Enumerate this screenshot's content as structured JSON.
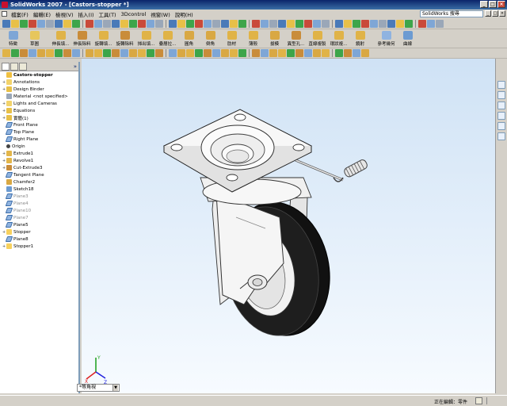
{
  "window": {
    "title": "SolidWorks 2007 - [Castors-stopper *]"
  },
  "menu": {
    "items": [
      "檔案(F)",
      "編輯(E)",
      "檢視(V)",
      "插入(I)",
      "工具(T)",
      "3Dcontrol",
      "視窗(W)",
      "說明(H)"
    ],
    "search_placeholder": "SolidWorks 搜尋"
  },
  "toolbar2": {
    "items": [
      {
        "label": "特徵",
        "icon": "feature-icon"
      },
      {
        "label": "草圖",
        "icon": "sketch-icon"
      },
      {
        "label": "伸長填...",
        "icon": "extruded-boss-icon"
      },
      {
        "label": "伸長除料",
        "icon": "extruded-cut-icon"
      },
      {
        "label": "旋轉填...",
        "icon": "revolved-boss-icon"
      },
      {
        "label": "旋轉除料",
        "icon": "revolved-cut-icon"
      },
      {
        "label": "掃出填...",
        "icon": "sweep-icon"
      },
      {
        "label": "疊層拉...",
        "icon": "loft-icon"
      },
      {
        "label": "圓角",
        "icon": "fillet-icon"
      },
      {
        "label": "倒角",
        "icon": "chamfer-icon"
      },
      {
        "label": "肋材",
        "icon": "rib-icon"
      },
      {
        "label": "薄殼",
        "icon": "shell-icon"
      },
      {
        "label": "拔模",
        "icon": "draft-icon"
      },
      {
        "label": "異型孔...",
        "icon": "hole-wizard-icon"
      },
      {
        "label": "直線複製",
        "icon": "linear-pattern-icon"
      },
      {
        "label": "環狀複...",
        "icon": "circular-pattern-icon"
      },
      {
        "label": "鏡射",
        "icon": "mirror-icon"
      },
      {
        "label": "參考幾何",
        "icon": "reference-geometry-icon"
      },
      {
        "label": "曲線",
        "icon": "curves-icon"
      }
    ]
  },
  "feature_tree": {
    "items": [
      {
        "label": "Castors-stopper",
        "icon": "part-icon",
        "expand": "",
        "dim": false,
        "root": true
      },
      {
        "label": "Annotations",
        "icon": "annotations-icon",
        "expand": "+",
        "dim": false
      },
      {
        "label": "Design Binder",
        "icon": "design-binder-icon",
        "expand": "+",
        "dim": false
      },
      {
        "label": "Material <not specified>",
        "icon": "material-icon",
        "expand": "",
        "dim": false
      },
      {
        "label": "Lights and Cameras",
        "icon": "lights-icon",
        "expand": "+",
        "dim": false
      },
      {
        "label": "Equations",
        "icon": "equations-icon",
        "expand": "+",
        "dim": false
      },
      {
        "label": "實體(1)",
        "icon": "solid-bodies-icon",
        "expand": "+",
        "dim": false
      },
      {
        "label": "Front Plane",
        "icon": "plane-icon",
        "expand": "",
        "dim": false
      },
      {
        "label": "Top Plane",
        "icon": "plane-icon",
        "expand": "",
        "dim": false
      },
      {
        "label": "Right Plane",
        "icon": "plane-icon",
        "expand": "",
        "dim": false
      },
      {
        "label": "Origin",
        "icon": "origin-icon",
        "expand": "",
        "dim": false
      },
      {
        "label": "Extrude1",
        "icon": "extrude-icon",
        "expand": "+",
        "dim": false
      },
      {
        "label": "Revolve1",
        "icon": "revolve-icon",
        "expand": "+",
        "dim": false
      },
      {
        "label": "Cut-Extrude3",
        "icon": "cut-extrude-icon",
        "expand": "+",
        "dim": false
      },
      {
        "label": "Tangent Plane",
        "icon": "plane-icon",
        "expand": "",
        "dim": false
      },
      {
        "label": "Chamfer2",
        "icon": "chamfer-icon",
        "expand": "",
        "dim": false
      },
      {
        "label": "Sketch18",
        "icon": "sketch-icon",
        "expand": "",
        "dim": false
      },
      {
        "label": "Plane3",
        "icon": "plane-icon",
        "expand": "",
        "dim": true
      },
      {
        "label": "Plane4",
        "icon": "plane-icon",
        "expand": "",
        "dim": true
      },
      {
        "label": "Plane10",
        "icon": "plane-icon",
        "expand": "",
        "dim": true
      },
      {
        "label": "Plane7",
        "icon": "plane-icon",
        "expand": "",
        "dim": true
      },
      {
        "label": "Plane5",
        "icon": "plane-icon",
        "expand": "",
        "dim": false
      },
      {
        "label": "Stopper",
        "icon": "folder-icon",
        "expand": "+",
        "dim": false
      },
      {
        "label": "Plane8",
        "icon": "plane-icon",
        "expand": "",
        "dim": false
      },
      {
        "label": "Stopper1",
        "icon": "folder-icon",
        "expand": "+",
        "dim": false
      }
    ]
  },
  "config_tab": {
    "label": "*等角視"
  },
  "status": {
    "text": "正在編輯：零件"
  },
  "colors": {
    "viewport_top": "#cfe2f5",
    "viewport_bottom": "#f7fbff",
    "wheel": "#1a1a1a",
    "metal": "#eaeaea"
  }
}
